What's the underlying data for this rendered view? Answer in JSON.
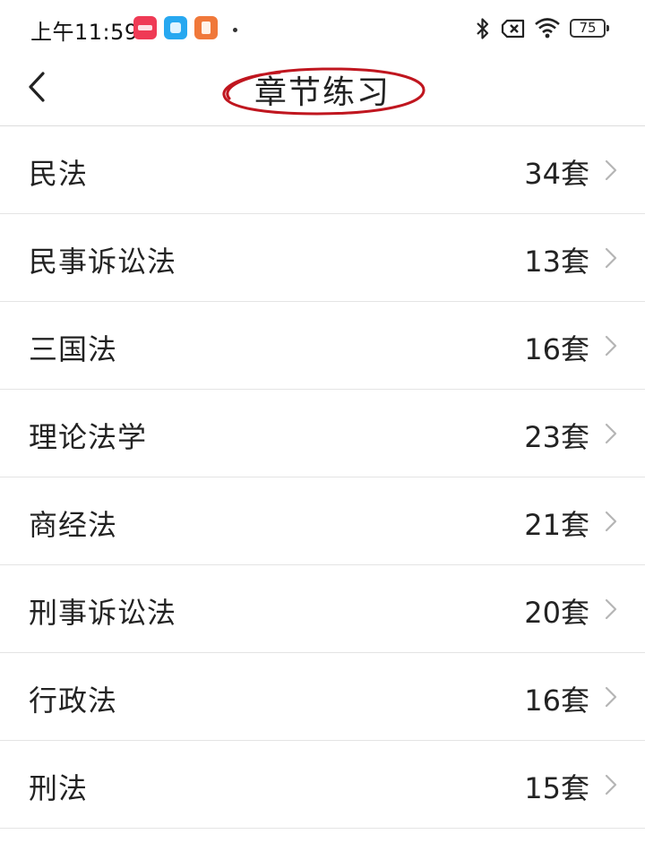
{
  "status_bar": {
    "time": "上午11:59",
    "battery": "75"
  },
  "header": {
    "title": "章节练习",
    "title_annotation_color": "#c0161f"
  },
  "chapters": [
    {
      "name": "民法",
      "count": "34套"
    },
    {
      "name": "民事诉讼法",
      "count": "13套"
    },
    {
      "name": "三国法",
      "count": "16套"
    },
    {
      "name": "理论法学",
      "count": "23套"
    },
    {
      "name": "商经法",
      "count": "21套"
    },
    {
      "name": "刑事诉讼法",
      "count": "20套"
    },
    {
      "name": "行政法",
      "count": "16套"
    },
    {
      "name": "刑法",
      "count": "15套"
    }
  ]
}
